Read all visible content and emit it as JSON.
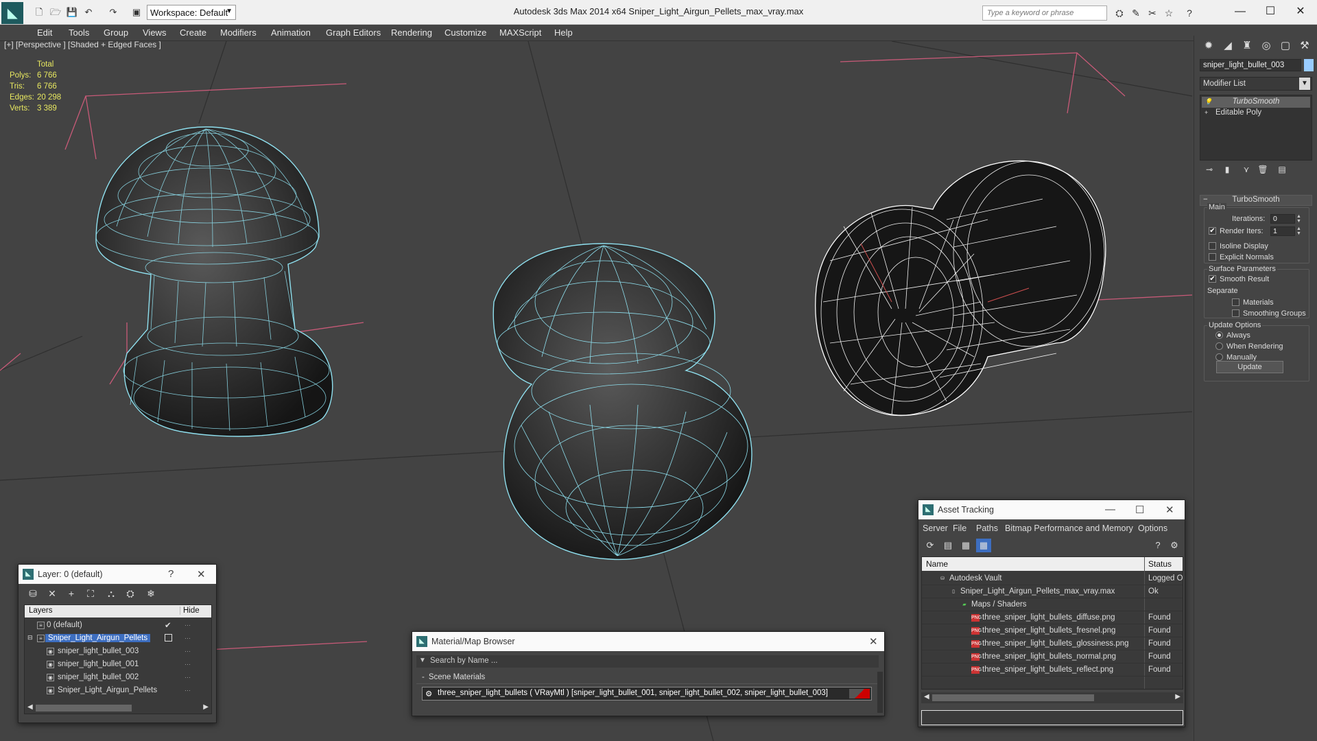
{
  "titlebar": {
    "title": "Autodesk 3ds Max  2014 x64      Sniper_Light_Airgun_Pellets_max_vray.max",
    "workspace": "Workspace: Default",
    "search_placeholder": "Type a keyword or phrase"
  },
  "menu": [
    "Edit",
    "Tools",
    "Group",
    "Views",
    "Create",
    "Modifiers",
    "Animation",
    "Graph Editors",
    "Rendering",
    "Customize",
    "MAXScript",
    "Help"
  ],
  "viewport": {
    "label": "[+] [Perspective ] [Shaded + Edged Faces ]",
    "stats": {
      "total_label": "Total",
      "polys_label": "Polys:",
      "polys": "6 766",
      "tris_label": "Tris:",
      "tris": "6 766",
      "edges_label": "Edges:",
      "edges": "20 298",
      "verts_label": "Verts:",
      "verts": "3 389"
    }
  },
  "command_panel": {
    "object_name": "sniper_light_bullet_003",
    "modifier_list": "Modifier List",
    "stack": [
      "TurboSmooth",
      "Editable Poly"
    ],
    "rollout_title": "TurboSmooth",
    "main_label": "Main",
    "iterations_label": "Iterations:",
    "iterations": "0",
    "render_iters_label": "Render Iters:",
    "render_iters": "1",
    "isoline_label": "Isoline Display",
    "explicit_normals_label": "Explicit Normals",
    "surface_params_label": "Surface Parameters",
    "smooth_result_label": "Smooth Result",
    "separate_label": "Separate",
    "materials_label": "Materials",
    "smoothing_groups_label": "Smoothing Groups",
    "update_options_label": "Update Options",
    "always_label": "Always",
    "when_rendering_label": "When Rendering",
    "manually_label": "Manually",
    "update_button": "Update"
  },
  "layer_window": {
    "title": "Layer: 0 (default)",
    "col_layers": "Layers",
    "col_hide": "Hide",
    "rows": [
      "0 (default)",
      "Sniper_Light_Airgun_Pellets",
      "sniper_light_bullet_003",
      "sniper_light_bullet_001",
      "sniper_light_bullet_002",
      "Sniper_Light_Airgun_Pellets"
    ]
  },
  "material_browser": {
    "title": "Material/Map Browser",
    "search_placeholder": "Search by Name ...",
    "section": "Scene Materials",
    "material": "three_sniper_light_bullets  ( VRayMtl ) [sniper_light_bullet_001, sniper_light_bullet_002, sniper_light_bullet_003]"
  },
  "asset_tracking": {
    "title": "Asset Tracking",
    "menu": [
      "Server",
      "File",
      "Paths",
      "Bitmap Performance and Memory",
      "Options"
    ],
    "col_name": "Name",
    "col_status": "Status",
    "rows": [
      {
        "name": "Autodesk Vault",
        "status": "Logged Out"
      },
      {
        "name": "Sniper_Light_Airgun_Pellets_max_vray.max",
        "status": "Ok"
      },
      {
        "name": "Maps / Shaders",
        "status": ""
      },
      {
        "name": "three_sniper_light_bullets_diffuse.png",
        "status": "Found"
      },
      {
        "name": "three_sniper_light_bullets_fresnel.png",
        "status": "Found"
      },
      {
        "name": "three_sniper_light_bullets_glossiness.png",
        "status": "Found"
      },
      {
        "name": "three_sniper_light_bullets_normal.png",
        "status": "Found"
      },
      {
        "name": "three_sniper_light_bullets_reflect.png",
        "status": "Found"
      }
    ]
  }
}
